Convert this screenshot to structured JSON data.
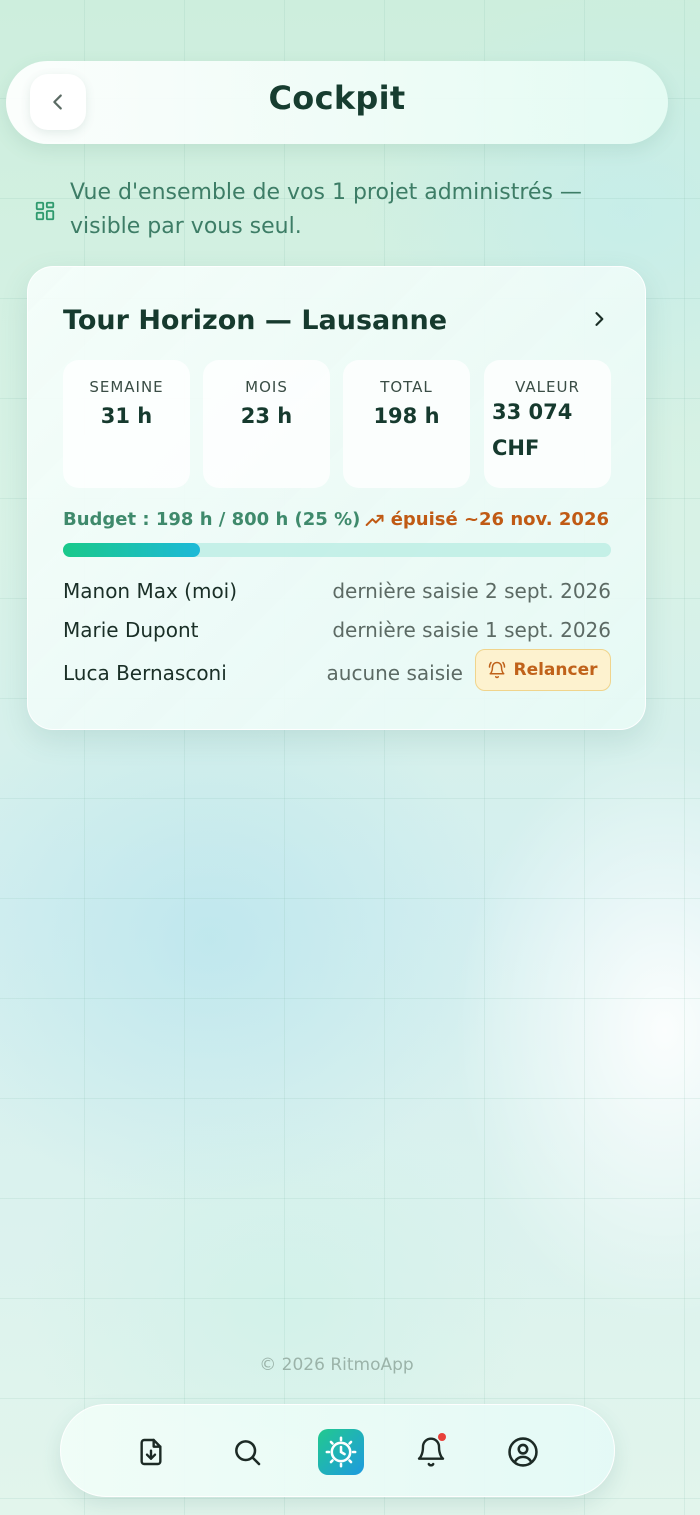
{
  "header": {
    "title": "Cockpit"
  },
  "intro": {
    "text": "Vue d'ensemble de vos 1 projet administrés — visible par vous seul."
  },
  "project": {
    "name": "Tour Horizon — Lausanne",
    "stats": [
      {
        "label": "SEMAINE",
        "value": "31 h"
      },
      {
        "label": "MOIS",
        "value": "23 h"
      },
      {
        "label": "TOTAL",
        "value": "198 h"
      },
      {
        "label": "VALEUR",
        "value": "33 074 CHF"
      }
    ],
    "budget": {
      "label": "Budget : 198 h / 800 h (25 %)",
      "percent": 25,
      "forecast": "épuisé ~26 nov. 2026"
    },
    "members": [
      {
        "name": "Manon Max (moi)",
        "status": "dernière saisie 2 sept. 2026"
      },
      {
        "name": "Marie Dupont",
        "status": "dernière saisie 1 sept. 2026"
      },
      {
        "name": "Luca Bernasconi",
        "status": "aucune saisie",
        "action": "Relancer"
      }
    ]
  },
  "footer": {
    "text": "© 2026 RitmoApp"
  },
  "nav": {
    "items": [
      {
        "icon": "file-download-icon"
      },
      {
        "icon": "search-icon"
      },
      {
        "icon": "clock-icon",
        "active": true
      },
      {
        "icon": "bell-icon",
        "has_notification": true
      },
      {
        "icon": "user-circle-icon"
      }
    ]
  },
  "colors": {
    "accent_green": "#19c98a",
    "accent_blue": "#1db9d8",
    "warning": "#c05a14"
  }
}
